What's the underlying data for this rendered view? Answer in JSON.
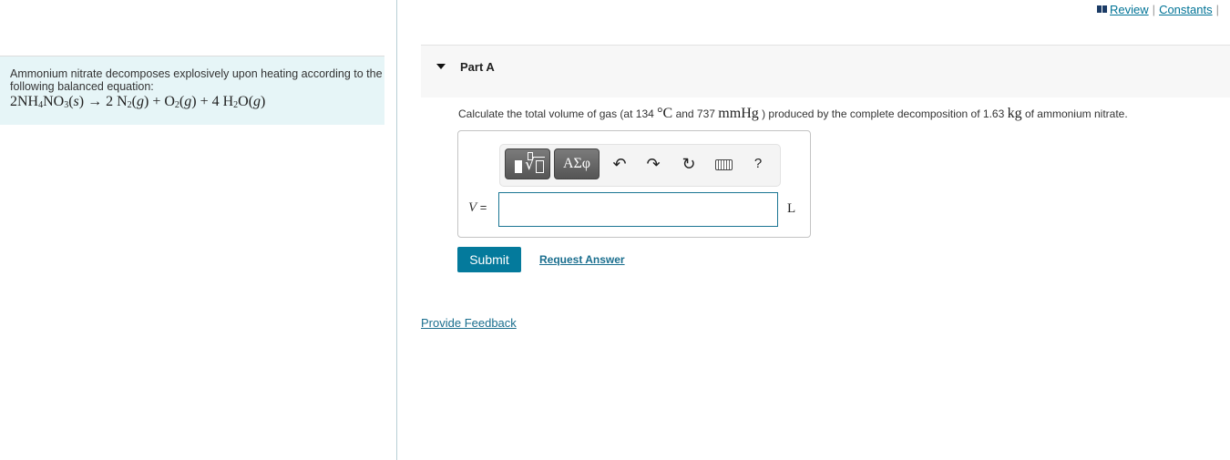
{
  "top_links": {
    "review": "Review",
    "separator": "|",
    "constants": "Constants"
  },
  "intro": {
    "text": "Ammonium nitrate decomposes explosively upon heating according to the following balanced equation:",
    "equation": {
      "reactant_coef": "2",
      "reactant": "NH4NO3",
      "reactant_state": "(s)",
      "arrow": "→",
      "products": [
        {
          "coef": "2",
          "formula": "N2",
          "state": "(g)"
        },
        {
          "coef": "",
          "formula": "O2",
          "state": "(g)"
        },
        {
          "coef": "4",
          "formula": "H2O",
          "state": "(g)"
        }
      ]
    }
  },
  "part": {
    "title": "Part A",
    "question": {
      "pre": "Calculate the total volume of gas (at 134",
      "temp_unit": "°C",
      "mid": "and 737",
      "pressure_unit": "mmHg",
      "post1": ") produced by the complete decomposition of 1.63",
      "mass_unit": "kg",
      "post2": "of ammonium nitrate."
    }
  },
  "toolbar": {
    "greek_label": "ΑΣφ",
    "help_label": "?"
  },
  "answer": {
    "variable": "V",
    "equals": "=",
    "value": "",
    "unit": "L"
  },
  "actions": {
    "submit": "Submit",
    "request_answer": "Request Answer",
    "provide_feedback": "Provide Feedback"
  }
}
